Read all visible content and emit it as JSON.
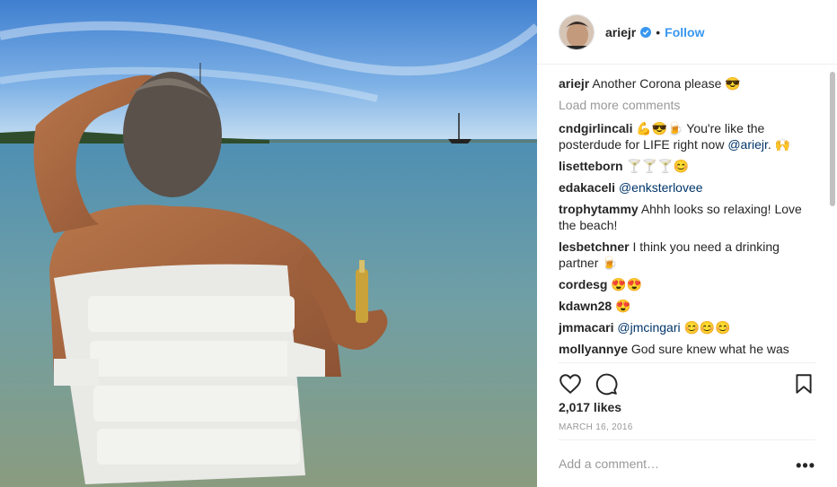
{
  "post": {
    "username": "ariejr",
    "follow_label": "Follow",
    "separator": "•",
    "caption_user": "ariejr",
    "caption_text": "Another Corona please 😎",
    "load_more_label": "Load more comments",
    "likes": "2,017 likes",
    "date": "MARCH 16, 2016",
    "add_comment_placeholder": "Add a comment…",
    "more_options": "•••"
  },
  "comments": [
    {
      "user": "cndgirlincali",
      "text": "💪😎🍺 You're like the posterdude for LIFE right now ",
      "mention": "@ariejr",
      "after": ". 🙌"
    },
    {
      "user": "lisetteborn",
      "text": "🍸🍸🍸😊",
      "mention": "",
      "after": ""
    },
    {
      "user": "edakaceli",
      "text": "",
      "mention": "@enksterlovee",
      "after": ""
    },
    {
      "user": "trophytammy",
      "text": "Ahhh looks so relaxing! Love the beach!",
      "mention": "",
      "after": ""
    },
    {
      "user": "lesbetchner",
      "text": "I think you need a drinking partner 🍺",
      "mention": "",
      "after": ""
    },
    {
      "user": "cordesg",
      "text": "😍😍",
      "mention": "",
      "after": ""
    },
    {
      "user": "kdawn28",
      "text": "😍",
      "mention": "",
      "after": ""
    },
    {
      "user": "jmmacari",
      "text": "",
      "mention": "@jmcingari",
      "after": " 😊😊😊"
    },
    {
      "user": "mollyannye",
      "text": "God sure knew what he was",
      "mention": "",
      "after": ""
    }
  ],
  "icons": {
    "like": "heart-icon",
    "comment": "comment-icon",
    "save": "bookmark-icon",
    "verified": "verified-badge-icon"
  },
  "colors": {
    "link": "#3897f0",
    "mention": "#003569",
    "muted": "#999999"
  }
}
